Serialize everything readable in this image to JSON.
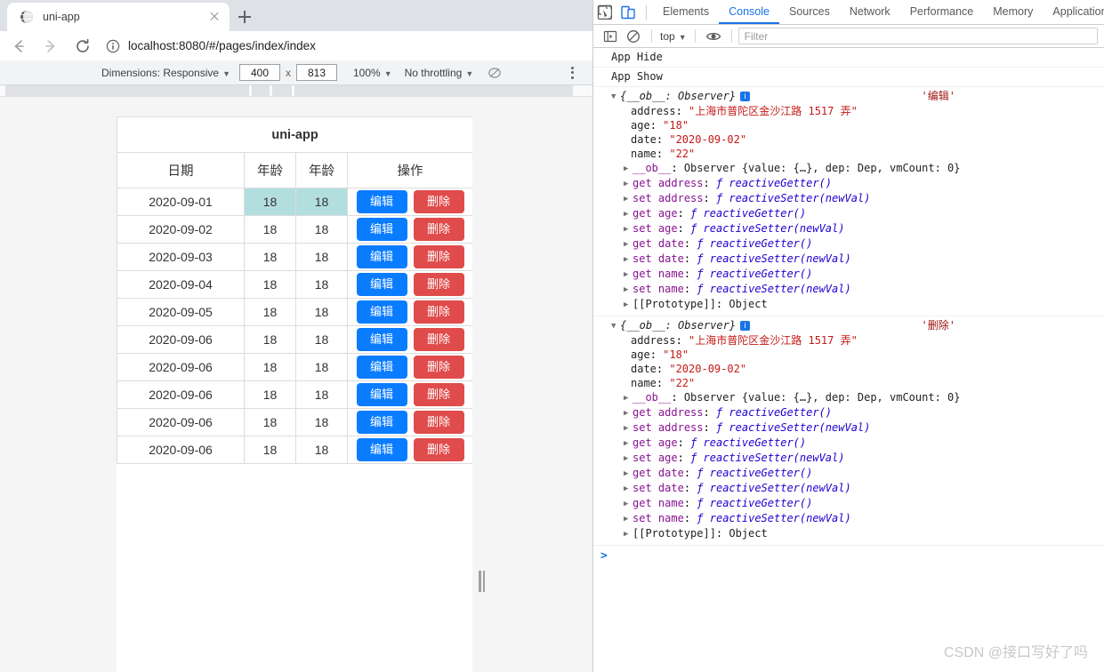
{
  "browser": {
    "tab": {
      "title": "uni-app",
      "favicon": "globe-icon",
      "close": "×"
    },
    "new_tab_label": "+",
    "nav": {
      "back": "←",
      "forward": "→",
      "reload": "⟳"
    },
    "url": "localhost:8080/#/pages/index/index",
    "site_info_icon": "info-circle-icon"
  },
  "device_toolbar": {
    "dimensions_label": "Dimensions: Responsive",
    "width": "400",
    "x": "x",
    "height": "813",
    "zoom": "100%",
    "throttling": "No throttling",
    "no_throttle_icon": "no-throttling-icon",
    "more_icon": "more-vertical-icon"
  },
  "page": {
    "title": "uni-app",
    "table": {
      "headers": [
        "日期",
        "年龄",
        "年龄",
        "操作"
      ],
      "rows": [
        {
          "date": "2020-09-01",
          "age1": "18",
          "age2": "18",
          "highlight": true
        },
        {
          "date": "2020-09-02",
          "age1": "18",
          "age2": "18",
          "highlight": false
        },
        {
          "date": "2020-09-03",
          "age1": "18",
          "age2": "18",
          "highlight": false
        },
        {
          "date": "2020-09-04",
          "age1": "18",
          "age2": "18",
          "highlight": false
        },
        {
          "date": "2020-09-05",
          "age1": "18",
          "age2": "18",
          "highlight": false
        },
        {
          "date": "2020-09-06",
          "age1": "18",
          "age2": "18",
          "highlight": false
        },
        {
          "date": "2020-09-06",
          "age1": "18",
          "age2": "18",
          "highlight": false
        },
        {
          "date": "2020-09-06",
          "age1": "18",
          "age2": "18",
          "highlight": false
        },
        {
          "date": "2020-09-06",
          "age1": "18",
          "age2": "18",
          "highlight": false
        },
        {
          "date": "2020-09-06",
          "age1": "18",
          "age2": "18",
          "highlight": false
        }
      ],
      "edit_label": "编辑",
      "delete_label": "删除"
    },
    "colors": {
      "edit_button": "#0a7cff",
      "delete_button": "#e04b4b",
      "highlight_cell": "#b3dee0"
    }
  },
  "devtools": {
    "inspect_icon": "inspect-element-icon",
    "device_toolbar_icon": "device-toolbar-icon",
    "tabs": [
      {
        "label": "Elements",
        "selected": false
      },
      {
        "label": "Console",
        "selected": true
      },
      {
        "label": "Sources",
        "selected": false
      },
      {
        "label": "Network",
        "selected": false
      },
      {
        "label": "Performance",
        "selected": false
      },
      {
        "label": "Memory",
        "selected": false
      },
      {
        "label": "Application",
        "selected": false
      }
    ],
    "subbar": {
      "sidebar_icon": "console-sidebar-icon",
      "clear_icon": "clear-console-icon",
      "context": "top",
      "eye_icon": "live-expression-icon",
      "filter_placeholder": "Filter"
    },
    "console": {
      "simple_logs": [
        "App Hide",
        "App Show"
      ],
      "groups": [
        {
          "header": "{__ob__: Observer}",
          "source_label": "'编辑'",
          "props": [
            {
              "key": "address",
              "value": "\"上海市普陀区金沙江路 1517 弄\"",
              "kind": "string"
            },
            {
              "key": "age",
              "value": "\"18\"",
              "kind": "string"
            },
            {
              "key": "date",
              "value": "\"2020-09-02\"",
              "kind": "string"
            },
            {
              "key": "name",
              "value": "\"22\"",
              "kind": "string"
            }
          ],
          "accessors": [
            {
              "kw": "",
              "key": "__ob__",
              "value": "Observer {value: {…}, dep: Dep, vmCount: 0}",
              "kind": "plain"
            },
            {
              "kw": "get",
              "key": "address",
              "value": "reactiveGetter()",
              "kind": "fn"
            },
            {
              "kw": "set",
              "key": "address",
              "value": "reactiveSetter(newVal)",
              "kind": "fn"
            },
            {
              "kw": "get",
              "key": "age",
              "value": "reactiveGetter()",
              "kind": "fn"
            },
            {
              "kw": "set",
              "key": "age",
              "value": "reactiveSetter(newVal)",
              "kind": "fn"
            },
            {
              "kw": "get",
              "key": "date",
              "value": "reactiveGetter()",
              "kind": "fn"
            },
            {
              "kw": "set",
              "key": "date",
              "value": "reactiveSetter(newVal)",
              "kind": "fn"
            },
            {
              "kw": "get",
              "key": "name",
              "value": "reactiveGetter()",
              "kind": "fn"
            },
            {
              "kw": "set",
              "key": "name",
              "value": "reactiveSetter(newVal)",
              "kind": "fn"
            },
            {
              "kw": "",
              "key": "[[Prototype]]",
              "value": "Object",
              "kind": "plain"
            }
          ]
        },
        {
          "header": "{__ob__: Observer}",
          "source_label": "'删除'",
          "props": [
            {
              "key": "address",
              "value": "\"上海市普陀区金沙江路 1517 弄\"",
              "kind": "string"
            },
            {
              "key": "age",
              "value": "\"18\"",
              "kind": "string"
            },
            {
              "key": "date",
              "value": "\"2020-09-02\"",
              "kind": "string"
            },
            {
              "key": "name",
              "value": "\"22\"",
              "kind": "string"
            }
          ],
          "accessors": [
            {
              "kw": "",
              "key": "__ob__",
              "value": "Observer {value: {…}, dep: Dep, vmCount: 0}",
              "kind": "plain"
            },
            {
              "kw": "get",
              "key": "address",
              "value": "reactiveGetter()",
              "kind": "fn"
            },
            {
              "kw": "set",
              "key": "address",
              "value": "reactiveSetter(newVal)",
              "kind": "fn"
            },
            {
              "kw": "get",
              "key": "age",
              "value": "reactiveGetter()",
              "kind": "fn"
            },
            {
              "kw": "set",
              "key": "age",
              "value": "reactiveSetter(newVal)",
              "kind": "fn"
            },
            {
              "kw": "get",
              "key": "date",
              "value": "reactiveGetter()",
              "kind": "fn"
            },
            {
              "kw": "set",
              "key": "date",
              "value": "reactiveSetter(newVal)",
              "kind": "fn"
            },
            {
              "kw": "get",
              "key": "name",
              "value": "reactiveGetter()",
              "kind": "fn"
            },
            {
              "kw": "set",
              "key": "name",
              "value": "reactiveSetter(newVal)",
              "kind": "fn"
            },
            {
              "kw": "",
              "key": "[[Prototype]]",
              "value": "Object",
              "kind": "plain"
            }
          ]
        }
      ],
      "prompt": ">"
    }
  },
  "watermark": "CSDN @接口写好了吗"
}
